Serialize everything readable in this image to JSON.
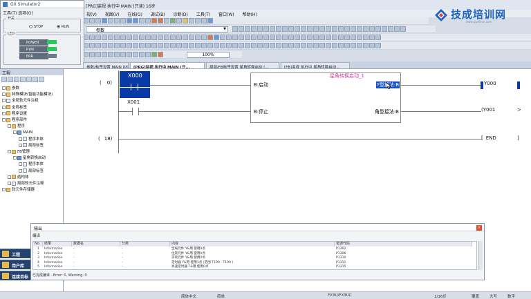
{
  "window_title": "[PRG]监视 执行中 MAIN (只读) 16步",
  "menu": [
    "视(V)",
    "视图(V)",
    "在线(O)",
    "调试(B)",
    "诊断(D)",
    "工具(T)",
    "窗口(W)",
    "帮助(H)"
  ],
  "logo": {
    "name": "技成培训网",
    "url": "www.jcpeixun.com"
  },
  "toolbar": {
    "param_dropdown": "参数",
    "zoom": "100%"
  },
  "simulator": {
    "title": "GX Simulator2",
    "menu": "工具(T)  选项(O)",
    "switch_group": "开关",
    "stop_label": "STOP",
    "run_label": "RUN",
    "led_group": "LED",
    "leds": [
      {
        "name": "POWER",
        "on": true
      },
      {
        "name": "RUN",
        "on": true
      },
      {
        "name": "ERR",
        "on": false
      }
    ]
  },
  "tabs": [
    "参数/标签设置 MAIN [PRG]",
    "[PRG]监视 执行中 MAIN (只...",
    "局部/FB标签设置 星角转换启动 [...",
    "[FB]监视 执行中 星角转换启动..."
  ],
  "nav": {
    "header": "工程",
    "tree": [
      {
        "label": "参数",
        "level": 0,
        "icon": "folder"
      },
      {
        "label": "特殊模块(智能功能模块)",
        "level": 0,
        "icon": "folder"
      },
      {
        "label": "全局软元件注释",
        "level": 0,
        "icon": "doc"
      },
      {
        "label": "全局标签",
        "level": 0,
        "icon": "folder"
      },
      {
        "label": "程序设置",
        "level": 0,
        "icon": "folder"
      },
      {
        "label": "程序部件",
        "level": 0,
        "icon": "folder"
      },
      {
        "label": "程序",
        "level": 1,
        "icon": "folder"
      },
      {
        "label": "MAIN",
        "level": 2,
        "icon": "prg"
      },
      {
        "label": "程序本体",
        "level": 3,
        "icon": "doc"
      },
      {
        "label": "局部标签",
        "level": 3,
        "icon": "doc"
      },
      {
        "label": "FB管理",
        "level": 1,
        "icon": "folder"
      },
      {
        "label": "星角转换启动",
        "level": 2,
        "icon": "prg"
      },
      {
        "label": "程序本体",
        "level": 3,
        "icon": "doc"
      },
      {
        "label": "局部标签",
        "level": 3,
        "icon": "doc"
      },
      {
        "label": "结构体",
        "level": 1,
        "icon": "folder"
      },
      {
        "label": "局部软元件注释",
        "level": 1,
        "icon": "doc"
      },
      {
        "label": "软元件存储器",
        "level": 0,
        "icon": "folder"
      }
    ],
    "buttons": [
      "工程",
      "用户库",
      "连接目标"
    ]
  },
  "ladder": {
    "step_0": "0)",
    "step_18": "18)",
    "contact1": "X000",
    "contact2": "X001",
    "fb_title": "星角转换启动_1",
    "fb_in1": "B:启动",
    "fb_in2": "B:停止",
    "fb_out1": "Y型接法:B",
    "fb_out2": "角型接法:B",
    "coil1": "Y000",
    "coil2": "Y001",
    "end": "END"
  },
  "output": {
    "title": "输出",
    "subtitle": "编译",
    "columns": [
      "No.",
      "结果",
      "数据名",
      "分类",
      "内容",
      "错误代码"
    ],
    "rows": [
      [
        "1",
        "Information",
        "-",
        "-",
        "全局元件 Y&用 使用0点",
        "P1302"
      ],
      [
        "2",
        "Information",
        "-",
        "-",
        "位软元件 Y&用 使用0点",
        "P1306"
      ],
      [
        "3",
        "Information",
        "-",
        "-",
        "字软元件 Y&用 使用0点",
        "P1310"
      ],
      [
        "4",
        "Information",
        "-",
        "-",
        "定时器 Y&用 使用1点 (范围 T199 - T199 )",
        "P1311"
      ],
      [
        "5",
        "Information",
        "-",
        "-",
        "高速定时器 T&用 使用0点",
        "P1315"
      ]
    ],
    "status": "已完成编译 - Error: 0, Warning: 0"
  },
  "statusbar": {
    "lang": "简体中文",
    "mode": "简单",
    "plc": "FX3U/FX3UC",
    "step": "1/16步",
    "ovr": "覆盖",
    "caps": "大写",
    "num": "数字"
  }
}
